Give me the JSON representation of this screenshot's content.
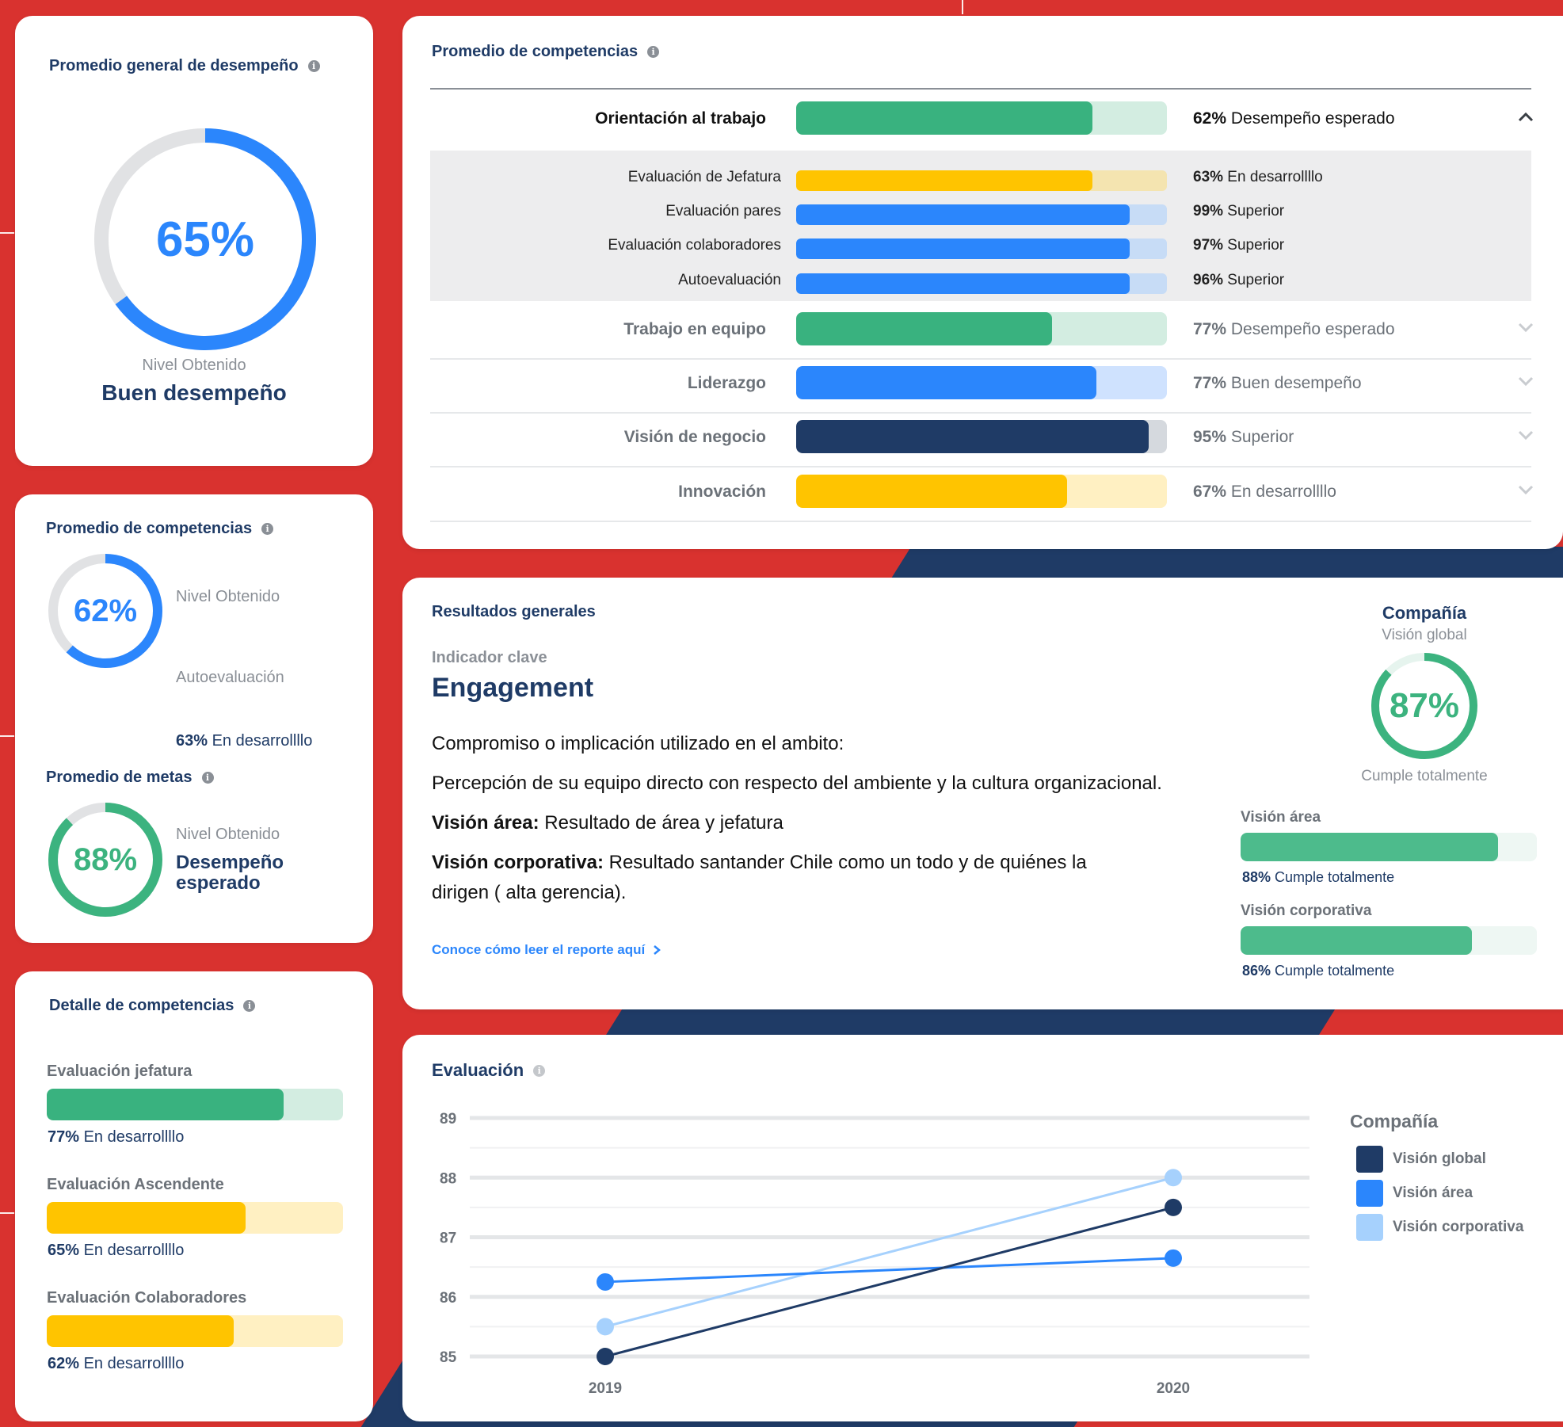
{
  "card_general": {
    "title": "Promedio general de desempeño",
    "value": "65%",
    "percent": 65,
    "level_label": "Nivel Obtenido",
    "level_value": "Buen desempeño",
    "color": "#2b86fc"
  },
  "card_competencias_small": {
    "title": "Promedio  de competencias",
    "value": "62%",
    "percent": 62,
    "level_label": "Nivel Obtenido",
    "sub_label": "Autoevaluación",
    "result_pct": "63%",
    "result_text": "En desarrollllo"
  },
  "card_metas": {
    "title": "Promedio  de metas",
    "value": "88%",
    "percent": 88,
    "level_label": "Nivel Obtenido",
    "level_value_line1": "Desempeño",
    "level_value_line2": "esperado",
    "color": "#3cb37f"
  },
  "card_detalle": {
    "title": "Detalle de competencias",
    "items": [
      {
        "label": "Evaluación jefatura",
        "pct": "77%",
        "status": "En desarrollllo",
        "value": 80,
        "color": "#39b27f",
        "track": "#d3ede1"
      },
      {
        "label": "Evaluación Ascendente",
        "pct": "65%",
        "status": "En desarrollllo",
        "value": 67,
        "color": "#ffc400",
        "track": "#fff0c2"
      },
      {
        "label": "Evaluación Colaboradores",
        "pct": "62%",
        "status": "En desarrollllo",
        "value": 63,
        "color": "#ffc400",
        "track": "#fff0c2"
      }
    ]
  },
  "card_prom_comp": {
    "title": "Promedio de competencias",
    "main_rows": [
      {
        "label": "Orientación al trabajo",
        "pct": "62%",
        "status": "Desempeño esperado",
        "value": 80,
        "color": "#39b27f",
        "track": "#d3ede1",
        "expanded": true
      },
      {
        "label": "Trabajo en equipo",
        "pct": "77%",
        "status": "Desempeño esperado",
        "value": 69,
        "color": "#39b27f",
        "track": "#d3ede1",
        "expanded": false
      },
      {
        "label": "Liderazgo",
        "pct": "77%",
        "status": "Buen desempeño",
        "value": 81,
        "color": "#2b86fc",
        "track": "#cfe2fe",
        "expanded": false
      },
      {
        "label": "Visión de negocio",
        "pct": "95%",
        "status": "Superior",
        "value": 95,
        "color": "#1f3b66",
        "track": "#d5d9de",
        "expanded": false
      },
      {
        "label": "Innovación",
        "pct": "67%",
        "status": "En desarrollllo",
        "value": 73,
        "color": "#ffc400",
        "track": "#fff0c2",
        "expanded": false
      }
    ],
    "sub_rows": [
      {
        "label": "Evaluación de Jefatura",
        "pct": "63%",
        "status": "En desarrollllo",
        "value": 80,
        "color": "#ffc400",
        "track": "#f4e4b0"
      },
      {
        "label": "Evaluación pares",
        "pct": "99%",
        "status": "Superior",
        "value": 90,
        "color": "#2b86fc",
        "track": "#c7dcf6"
      },
      {
        "label": "Evaluación colaboradores",
        "pct": "97%",
        "status": "Superior",
        "value": 90,
        "color": "#2b86fc",
        "track": "#c7dcf6"
      },
      {
        "label": "Autoevaluación",
        "pct": "96%",
        "status": "Superior",
        "value": 90,
        "color": "#2b86fc",
        "track": "#c7dcf6"
      }
    ]
  },
  "card_resultados": {
    "title": "Resultados generales",
    "indicator_label": "Indicador clave",
    "indicator_value": "Engagement",
    "desc_line1": "Compromiso o implicación utilizado en el ambito:",
    "desc_line2": "Percepción de su equipo directo con respecto del ambiente y la cultura organizacional.",
    "area_bold": "Visión área:",
    "area_text": " Resultado de área y jefatura",
    "corp_bold": "Visión corporativa:",
    "corp_text_1": " Resultado santander Chile como un todo y de quiénes la",
    "corp_text_2": "dirigen ( alta gerencia).",
    "link": "Conoce cómo leer el reporte aquí",
    "company_title": "Compañía",
    "company_sub": "Visión global",
    "company_value": "87%",
    "company_percent": 87,
    "company_status": "Cumple totalmente",
    "area_label": "Visión área",
    "area_pct": "88%",
    "area_status": "Cumple totalmente",
    "area_value": 87,
    "corp_label": "Visión corporativa",
    "corp_pct": "86%",
    "corp_status": "Cumple totalmente",
    "corp_value": 78
  },
  "card_evaluacion": {
    "title": "Evaluación",
    "legend_title": "Compañía",
    "legend": [
      {
        "name": "Visión global",
        "color": "#1f3b66"
      },
      {
        "name": "Visión área",
        "color": "#2b86fc"
      },
      {
        "name": "Visión corporativa",
        "color": "#a6d1fd"
      }
    ]
  },
  "chart_data": {
    "type": "line",
    "x": [
      "2019",
      "2020"
    ],
    "yticks": [
      89,
      88,
      87,
      86,
      85
    ],
    "ylim": [
      85,
      89
    ],
    "series": [
      {
        "name": "Visión global",
        "values": [
          85.0,
          87.5
        ],
        "color": "#1f3b66"
      },
      {
        "name": "Visión área",
        "values": [
          86.25,
          86.65
        ],
        "color": "#2b86fc"
      },
      {
        "name": "Visión corporativa",
        "values": [
          85.5,
          88.0
        ],
        "color": "#a6d1fd"
      }
    ],
    "legend": "right",
    "grid": true
  }
}
